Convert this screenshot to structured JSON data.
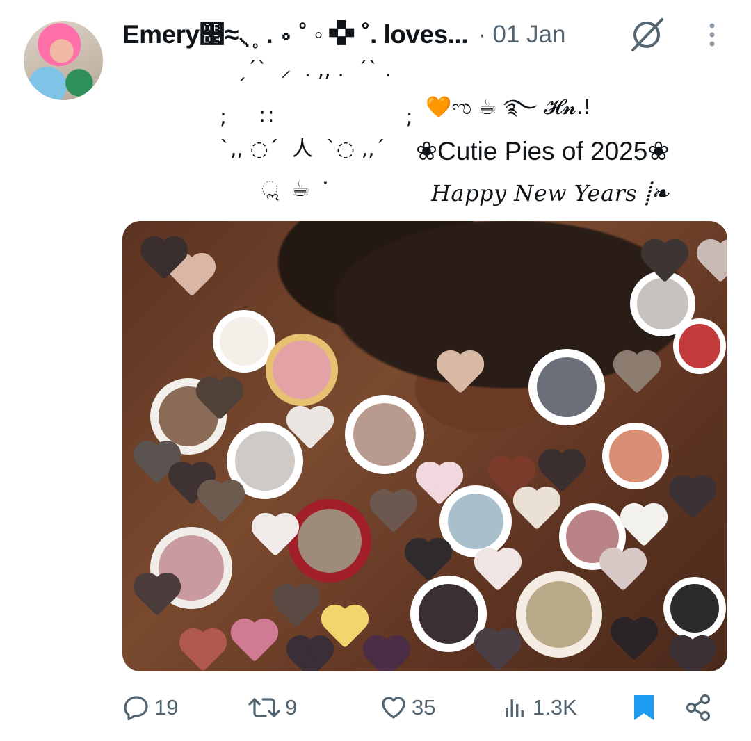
{
  "tweet": {
    "author_name": "Emery௓≈⸜˳ . ∘ ˚ ◦ ✜ ˚. loves...",
    "date": "· 01 Jan",
    "kaomoji_lines": [
      " ˏˊˋ  ⸝  . ,, .  ˊˋ .",
      ";     ∷                    ;",
      "`,, ◌´  人  `◌ ,,´",
      "ೢ  ☕  ་"
    ],
    "emoji_line": "🧡ಌ ☕ ࿐ 𝓗𝓷.!",
    "caption": "❀Cutie Pies of 2025❀",
    "script_line": "Happy New Years ⸽❧"
  },
  "actions": {
    "replies": "19",
    "reposts": "9",
    "likes": "35",
    "views": "1.3K"
  },
  "colors": {
    "text": "#0f1419",
    "muted": "#536471",
    "bookmark_active": "#1d9bf0"
  },
  "icons": [
    "grok-icon",
    "more-icon",
    "reply-icon",
    "repost-icon",
    "like-icon",
    "views-icon",
    "bookmark-icon",
    "share-icon"
  ]
}
